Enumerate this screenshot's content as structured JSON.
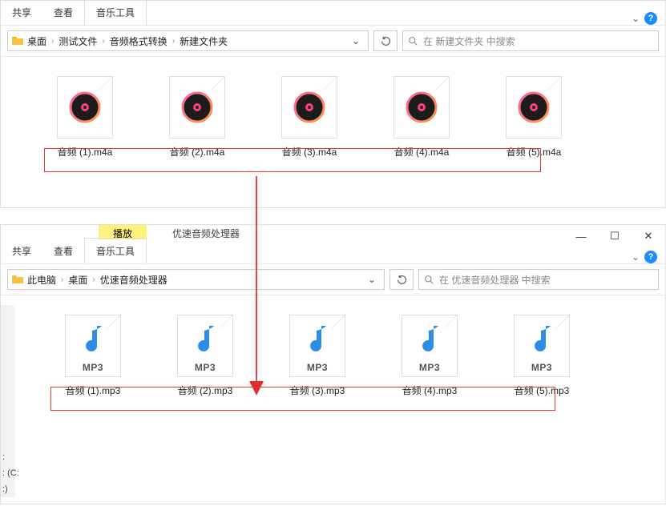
{
  "window1": {
    "tabs": {
      "share": "共享",
      "view": "查看",
      "music_tools": "音乐工具"
    },
    "breadcrumb": [
      "桌面",
      "测试文件",
      "音频格式转换",
      "新建文件夹"
    ],
    "search_placeholder": "在 新建文件夹 中搜索",
    "files": [
      {
        "name": "音频 (1).m4a"
      },
      {
        "name": "音频 (2).m4a"
      },
      {
        "name": "音频 (3).m4a"
      },
      {
        "name": "音频 (4).m4a"
      },
      {
        "name": "音频 (5).m4a"
      }
    ]
  },
  "window2": {
    "tabs": {
      "share": "共享",
      "view": "查看",
      "play": "播放",
      "app": "优速音频处理器",
      "music_tools": "音乐工具"
    },
    "breadcrumb": [
      "此电脑",
      "桌面",
      "优速音频处理器"
    ],
    "search_placeholder": "在 优速音频处理器 中搜索",
    "mp3_label": "MP3",
    "files": [
      {
        "name": "音频 (1).mp3"
      },
      {
        "name": "音频 (2).mp3"
      },
      {
        "name": "音频 (3).mp3"
      },
      {
        "name": "音频 (4).mp3"
      },
      {
        "name": "音频 (5).mp3"
      }
    ],
    "side_items": [
      ":",
      ": (C:",
      ":)"
    ]
  }
}
